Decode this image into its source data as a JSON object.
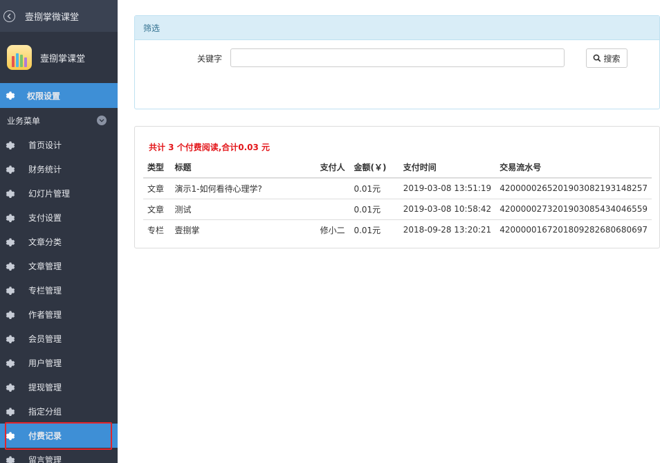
{
  "app": {
    "back_title": "壹捌掌微课堂",
    "brand_name": "壹捌掌课堂"
  },
  "sidebar": {
    "primary_item": "权限设置",
    "group_label": "业务菜单",
    "items": [
      {
        "label": "首页设计"
      },
      {
        "label": "财务统计"
      },
      {
        "label": "幻灯片管理"
      },
      {
        "label": "支付设置"
      },
      {
        "label": "文章分类"
      },
      {
        "label": "文章管理"
      },
      {
        "label": "专栏管理"
      },
      {
        "label": "作者管理"
      },
      {
        "label": "会员管理"
      },
      {
        "label": "用户管理"
      },
      {
        "label": "提现管理"
      },
      {
        "label": "指定分组"
      },
      {
        "label": "付费记录"
      },
      {
        "label": "留言管理"
      }
    ]
  },
  "filter": {
    "title": "筛选",
    "keyword_label": "关键字",
    "keyword_value": "",
    "search_label": "搜索"
  },
  "results": {
    "summary": "共计 3 个付费阅读,合计0.03 元",
    "columns": [
      "类型",
      "标题",
      "支付人",
      "金额(￥)",
      "支付时间",
      "交易流水号"
    ],
    "rows": [
      [
        "文章",
        "演示1-如何看待心理学?",
        "",
        "0.01元",
        "2019-03-08 13:51:19",
        "4200000265201903082193148257"
      ],
      [
        "文章",
        "测试",
        "",
        "0.01元",
        "2019-03-08 10:58:42",
        "4200000273201903085434046559"
      ],
      [
        "专栏",
        "壹捌掌",
        "修小二",
        "0.01元",
        "2018-09-28 13:20:21",
        "4200000167201809282680680697"
      ]
    ]
  },
  "colors": {
    "sidebar_bg": "#2f3542",
    "accent": "#3e8fd6",
    "summary_red": "#e3171b",
    "filter_header_bg": "#d9edf7"
  }
}
